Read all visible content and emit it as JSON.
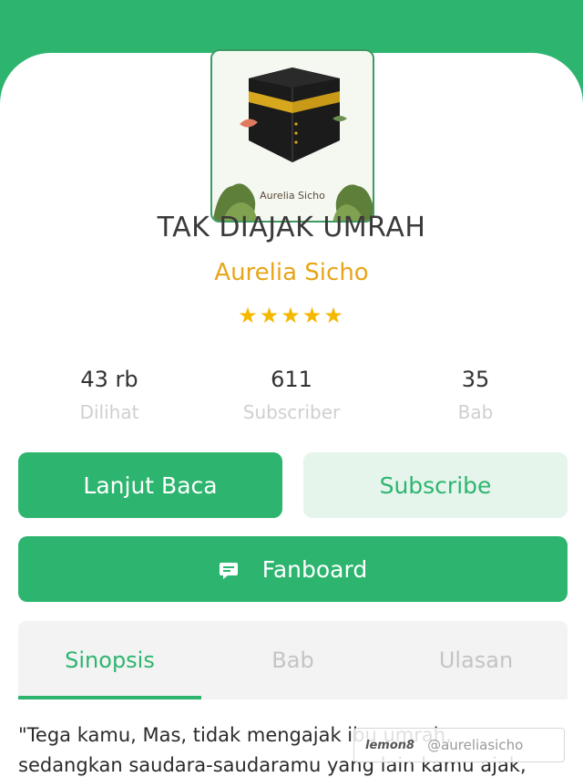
{
  "book": {
    "cover_author": "Aurelia Sicho",
    "title": "TAK DIAJAK UMRAH",
    "author": "Aurelia Sicho",
    "rating_stars": 5
  },
  "stats": [
    {
      "value": "43 rb",
      "label": "Dilihat"
    },
    {
      "value": "611",
      "label": "Subscriber"
    },
    {
      "value": "35",
      "label": "Bab"
    }
  ],
  "actions": {
    "read_label": "Lanjut Baca",
    "subscribe_label": "Subscribe",
    "fanboard_label": "Fanboard"
  },
  "tabs": {
    "items": [
      "Sinopsis",
      "Bab",
      "Ulasan"
    ],
    "active": "Sinopsis"
  },
  "synopsis": {
    "line1": "\"Tega kamu, Mas, tidak mengajak ibu umrah,",
    "line2": "sedangkan saudara-saudaramu yang lain kamu ajak,"
  },
  "watermark": {
    "logo": "lemon8",
    "handle": "@aureliasicho"
  },
  "colors": {
    "accent": "#2db56f",
    "author": "#e8a51a",
    "star": "#f5b800"
  }
}
